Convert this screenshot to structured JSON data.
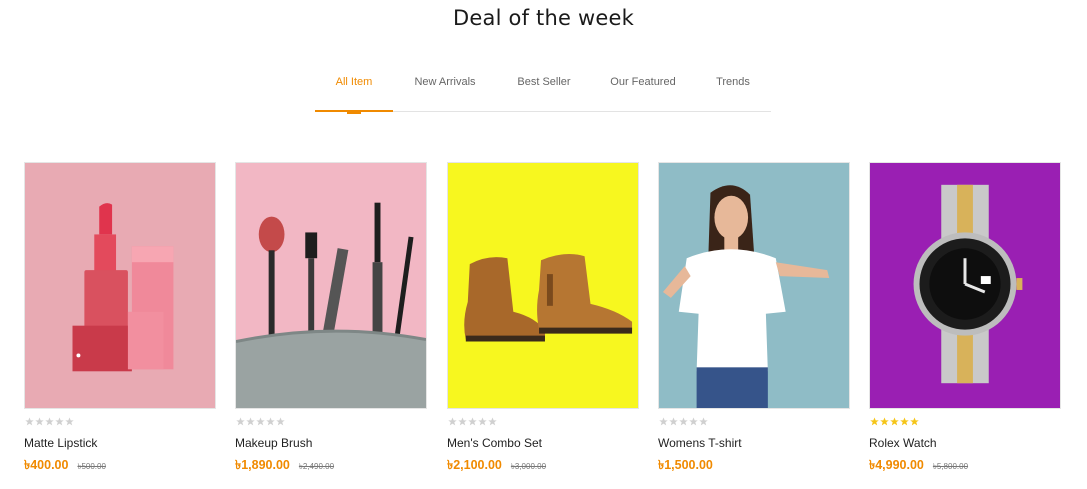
{
  "section": {
    "title": "Deal of the week"
  },
  "tabs": [
    {
      "label": "All Item",
      "active": true
    },
    {
      "label": "New Arrivals",
      "active": false
    },
    {
      "label": "Best Seller",
      "active": false
    },
    {
      "label": "Our Featured",
      "active": false
    },
    {
      "label": "Trends",
      "active": false
    }
  ],
  "colors": {
    "accent": "#f08a00",
    "star_empty": "#d0d0d0",
    "star_filled": "#f5c518"
  },
  "products": [
    {
      "name": "Matte Lipstick",
      "price": "৳400.00",
      "old_price": "৳500.00",
      "rating": 0,
      "bg": "#e8aab3",
      "icon": "lipstick-image"
    },
    {
      "name": "Makeup Brush",
      "price": "৳1,890.00",
      "old_price": "৳2,490.00",
      "rating": 0,
      "bg": "#f2b7c4",
      "icon": "makeup-brush-image"
    },
    {
      "name": "Men's Combo Set",
      "price": "৳2,100.00",
      "old_price": "৳3,000.00",
      "rating": 0,
      "bg": "#f7f71f",
      "icon": "boots-image"
    },
    {
      "name": "Womens T-shirt",
      "price": "৳1,500.00",
      "old_price": "",
      "rating": 0,
      "bg": "#8fbcc6",
      "icon": "woman-tshirt-image"
    },
    {
      "name": "Rolex Watch",
      "price": "৳4,990.00",
      "old_price": "৳5,800.00",
      "rating": 5,
      "bg": "#9a1fb3",
      "icon": "watch-image"
    }
  ]
}
